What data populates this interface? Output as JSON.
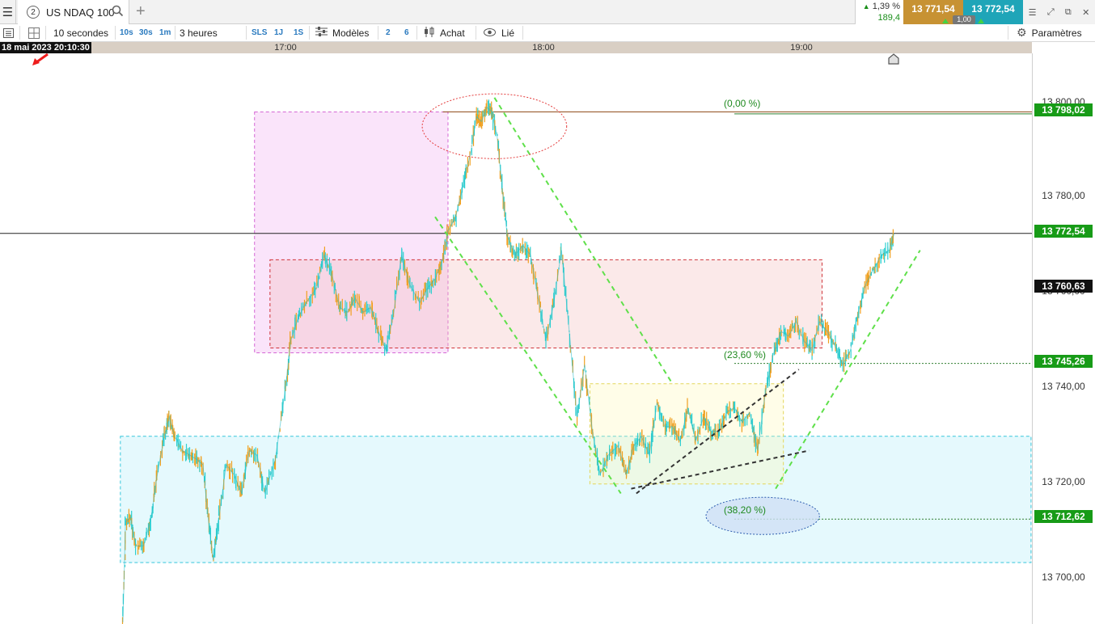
{
  "tabbar": {
    "tab_number": "2",
    "instrument": "US NDAQ 100",
    "quote_pct": "1,39 %",
    "quote_change": "189,4",
    "bid": "13 771,54",
    "ask": "13 772,54",
    "spread": "1,00"
  },
  "toolbar": {
    "interval": "10 secondes",
    "intervals": [
      "10s",
      "30s",
      "1m"
    ],
    "period": "3 heures",
    "periods": [
      "SLS",
      "1J",
      "1S"
    ],
    "models": "Modèles",
    "num_a": "2",
    "num_b": "6",
    "buy": "Achat",
    "linked": "Lié",
    "settings": "Paramètres"
  },
  "cursor_time": "18 mai 2023 20:10:30",
  "chart_data": {
    "type": "line",
    "instrument": "US NDAQ 100",
    "x_ticks": [
      "17:00",
      "18:00",
      "19:00"
    ],
    "y_ticks": [
      "13 800,00",
      "13 780,00",
      "13 760,00",
      "13 740,00",
      "13 720,00",
      "13 700,00"
    ],
    "ylim": [
      13688,
      13822
    ],
    "price_labels": [
      {
        "value": "13 798,02",
        "color": "#179b17"
      },
      {
        "value": "13 772,54",
        "color": "#179b17"
      },
      {
        "value": "13 760,63",
        "color": "#111111"
      },
      {
        "value": "13 745,26",
        "color": "#179b17"
      },
      {
        "value": "13 712,62",
        "color": "#179b17"
      }
    ],
    "fibonacci_levels": [
      {
        "label": "(0,00 %)",
        "price": 13798.02
      },
      {
        "label": "(23,60 %)",
        "price": 13745.26
      },
      {
        "label": "(38,20 %)",
        "price": 13712.62
      }
    ],
    "series": [
      {
        "values": [
          [
            16.37,
            13691
          ],
          [
            16.38,
            13712
          ],
          [
            16.4,
            13713
          ],
          [
            16.42,
            13707
          ],
          [
            16.45,
            13707
          ],
          [
            16.48,
            13713
          ],
          [
            16.5,
            13721
          ],
          [
            16.53,
            13730
          ],
          [
            16.55,
            13734
          ],
          [
            16.57,
            13730
          ],
          [
            16.6,
            13727
          ],
          [
            16.63,
            13726
          ],
          [
            16.66,
            13725
          ],
          [
            16.68,
            13724
          ],
          [
            16.7,
            13713
          ],
          [
            16.72,
            13704
          ],
          [
            16.74,
            13712
          ],
          [
            16.77,
            13724
          ],
          [
            16.8,
            13722
          ],
          [
            16.83,
            13718
          ],
          [
            16.86,
            13727
          ],
          [
            16.89,
            13726
          ],
          [
            16.92,
            13718
          ],
          [
            16.96,
            13725
          ],
          [
            17.0,
            13740
          ],
          [
            17.02,
            13750
          ],
          [
            17.05,
            13755
          ],
          [
            17.08,
            13758
          ],
          [
            17.12,
            13761
          ],
          [
            17.15,
            13768
          ],
          [
            17.18,
            13764
          ],
          [
            17.21,
            13757
          ],
          [
            17.24,
            13756
          ],
          [
            17.27,
            13759
          ],
          [
            17.3,
            13756
          ],
          [
            17.33,
            13757
          ],
          [
            17.36,
            13752
          ],
          [
            17.39,
            13748
          ],
          [
            17.42,
            13756
          ],
          [
            17.45,
            13768
          ],
          [
            17.48,
            13762
          ],
          [
            17.52,
            13758
          ],
          [
            17.55,
            13761
          ],
          [
            17.58,
            13763
          ],
          [
            17.61,
            13767
          ],
          [
            17.63,
            13773
          ],
          [
            17.66,
            13776
          ],
          [
            17.69,
            13783
          ],
          [
            17.72,
            13790
          ],
          [
            17.74,
            13797
          ],
          [
            17.76,
            13796
          ],
          [
            17.78,
            13799
          ],
          [
            17.8,
            13798
          ],
          [
            17.82,
            13793
          ],
          [
            17.84,
            13782
          ],
          [
            17.86,
            13772
          ],
          [
            17.89,
            13768
          ],
          [
            17.92,
            13770
          ],
          [
            17.95,
            13768
          ],
          [
            17.98,
            13759
          ],
          [
            18.01,
            13750
          ],
          [
            18.04,
            13758
          ],
          [
            18.07,
            13769
          ],
          [
            18.1,
            13752
          ],
          [
            18.13,
            13734
          ],
          [
            18.16,
            13745
          ],
          [
            18.19,
            13731
          ],
          [
            18.22,
            13722
          ],
          [
            18.25,
            13726
          ],
          [
            18.29,
            13728
          ],
          [
            18.32,
            13722
          ],
          [
            18.35,
            13728
          ],
          [
            18.38,
            13730
          ],
          [
            18.41,
            13726
          ],
          [
            18.44,
            13737
          ],
          [
            18.47,
            13732
          ],
          [
            18.5,
            13732
          ],
          [
            18.53,
            13729
          ],
          [
            18.56,
            13736
          ],
          [
            18.59,
            13729
          ],
          [
            18.62,
            13734
          ],
          [
            18.65,
            13731
          ],
          [
            18.68,
            13731
          ],
          [
            18.71,
            13735
          ],
          [
            18.74,
            13736
          ],
          [
            18.77,
            13733
          ],
          [
            18.8,
            13735
          ],
          [
            18.83,
            13727
          ],
          [
            18.86,
            13739
          ],
          [
            18.89,
            13747
          ],
          [
            18.92,
            13752
          ],
          [
            18.95,
            13751
          ],
          [
            18.98,
            13754
          ],
          [
            19.01,
            13750
          ],
          [
            19.04,
            13748
          ],
          [
            19.07,
            13754
          ],
          [
            19.1,
            13752
          ],
          [
            19.13,
            13749
          ],
          [
            19.16,
            13745
          ],
          [
            19.19,
            13748
          ],
          [
            19.22,
            13756
          ],
          [
            19.25,
            13762
          ],
          [
            19.28,
            13765
          ],
          [
            19.31,
            13768
          ],
          [
            19.34,
            13769
          ],
          [
            19.36,
            13772.54
          ]
        ]
      }
    ],
    "annotations": {
      "price_line": 13772.54,
      "zones": [
        {
          "name": "pink-zone",
          "x": [
            16.88,
            17.63
          ],
          "y": [
            13747.5,
            13798
          ],
          "color": "#f0a6f0"
        },
        {
          "name": "red-zone",
          "x": [
            16.94,
            19.08
          ],
          "y": [
            13748.5,
            13767
          ],
          "color": "#f2b6b6"
        },
        {
          "name": "cyan-zone",
          "x": [
            16.36,
            19.89
          ],
          "y": [
            13703.5,
            13730
          ],
          "color": "#a8ecf7"
        },
        {
          "name": "yellow-zone",
          "x": [
            18.18,
            18.93
          ],
          "y": [
            13720,
            13741
          ],
          "color": "#fff7b3"
        }
      ],
      "channel_lines": [
        [
          [
            17.58,
            13776
          ],
          [
            18.3,
            13718
          ]
        ],
        [
          [
            17.81,
            13801
          ],
          [
            18.5,
            13741
          ]
        ],
        [
          [
            18.9,
            13719
          ],
          [
            19.46,
            13769
          ]
        ]
      ],
      "dark_lines": [
        [
          [
            18.36,
            13718
          ],
          [
            18.99,
            13744
          ]
        ],
        [
          [
            18.34,
            13719
          ],
          [
            19.03,
            13727
          ]
        ]
      ],
      "ellipses": [
        {
          "name": "top-ellipse",
          "cx": 17.81,
          "cy": 13795,
          "rx": 0.28,
          "ry": 6.8,
          "color": "#e43c3c"
        },
        {
          "name": "bottom-ellipse",
          "cx": 18.85,
          "cy": 13713.3,
          "rx": 0.22,
          "ry": 3.9,
          "color": "#2f5fb0"
        }
      ]
    }
  }
}
